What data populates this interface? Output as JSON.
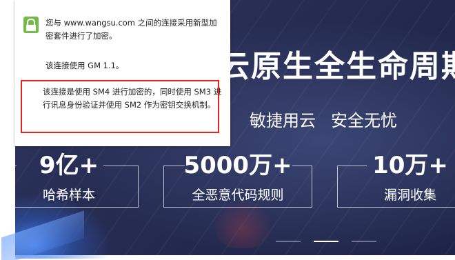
{
  "hero": {
    "headline": "云原生全生命周期",
    "sub_left": "敏捷用云",
    "sub_right": "安全无忧",
    "stats": [
      {
        "number": "9亿+",
        "label": "哈希样本"
      },
      {
        "number": "5000万+",
        "label": "全恶意代码规则"
      },
      {
        "number": "10万+",
        "label": "漏洞收集"
      }
    ],
    "carousel": {
      "count": 3,
      "active_index": 1
    }
  },
  "security_popup": {
    "icon": "lock-icon",
    "line1": "您与 www.wangsu.com 之间的连接采用新型加密套件进行了加密。",
    "line2": "该连接使用 GM 1.1。",
    "line3": "该连接是使用 SM4 进行加密的，同时使用 SM3 进行讯息身份验证并使用 SM2 作为密钥交换机制。",
    "highlight_color": "#e3231c"
  }
}
